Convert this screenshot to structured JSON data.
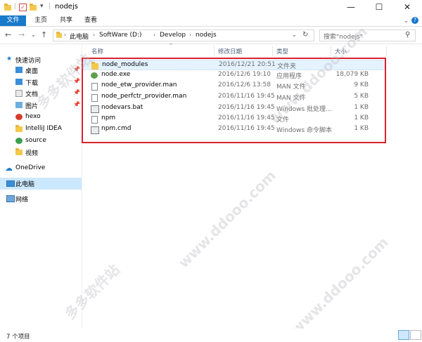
{
  "window": {
    "title": "nodejs",
    "minimize_glyph": "—",
    "maximize_glyph": "☐",
    "close_glyph": "✕"
  },
  "ribbon": {
    "file_tab": "文件",
    "tabs": [
      "主页",
      "共享",
      "查看"
    ]
  },
  "address": {
    "crumbs": [
      "此电脑",
      "SoftWare (D:)",
      "Develop",
      "nodejs"
    ],
    "search_placeholder": "搜索\"nodejs\""
  },
  "nav": {
    "quick_access": "快速访问",
    "items": [
      {
        "label": "桌面",
        "icon": "desktop-icon",
        "pinned": true
      },
      {
        "label": "下载",
        "icon": "download-icon",
        "pinned": true
      },
      {
        "label": "文档",
        "icon": "document-icon",
        "pinned": true
      },
      {
        "label": "图片",
        "icon": "picture-icon",
        "pinned": true
      },
      {
        "label": "hexo",
        "icon": "app-icon",
        "pinned": false
      },
      {
        "label": "IntelliJ IDEA",
        "icon": "folder-icon",
        "pinned": false
      },
      {
        "label": "source",
        "icon": "green-dot-icon",
        "pinned": false
      },
      {
        "label": "视频",
        "icon": "folder-icon",
        "pinned": false
      }
    ],
    "onedrive": "OneDrive",
    "this_pc": "此电脑",
    "network": "网络"
  },
  "columns": {
    "name": "名称",
    "date": "修改日期",
    "type": "类型",
    "size": "大小"
  },
  "files": [
    {
      "name": "node_modules",
      "date": "2016/12/21 20:51",
      "type": "文件夹",
      "size": "",
      "icon": "folder-icon"
    },
    {
      "name": "node.exe",
      "date": "2016/12/6 19:10",
      "type": "应用程序",
      "size": "18,079 KB",
      "icon": "nodejs-icon"
    },
    {
      "name": "node_etw_provider.man",
      "date": "2016/12/6 13:58",
      "type": "MAN 文件",
      "size": "9 KB",
      "icon": "file-icon"
    },
    {
      "name": "node_perfctr_provider.man",
      "date": "2016/11/16 19:45",
      "type": "MAN 文件",
      "size": "5 KB",
      "icon": "file-icon"
    },
    {
      "name": "nodevars.bat",
      "date": "2016/11/16 19:45",
      "type": "Windows 批处理...",
      "size": "1 KB",
      "icon": "batch-icon"
    },
    {
      "name": "npm",
      "date": "2016/11/16 19:45",
      "type": "文件",
      "size": "1 KB",
      "icon": "file-icon"
    },
    {
      "name": "npm.cmd",
      "date": "2016/11/16 19:45",
      "type": "Windows 命令脚本",
      "size": "1 KB",
      "icon": "batch-icon"
    }
  ],
  "status": {
    "item_count": "7 个项目"
  },
  "watermark": {
    "text": "多多软件站",
    "url": "www.ddooo.com"
  },
  "colors": {
    "accent": "#1979ca",
    "highlight_box": "#d9232d",
    "selection": "#cce8ff"
  }
}
